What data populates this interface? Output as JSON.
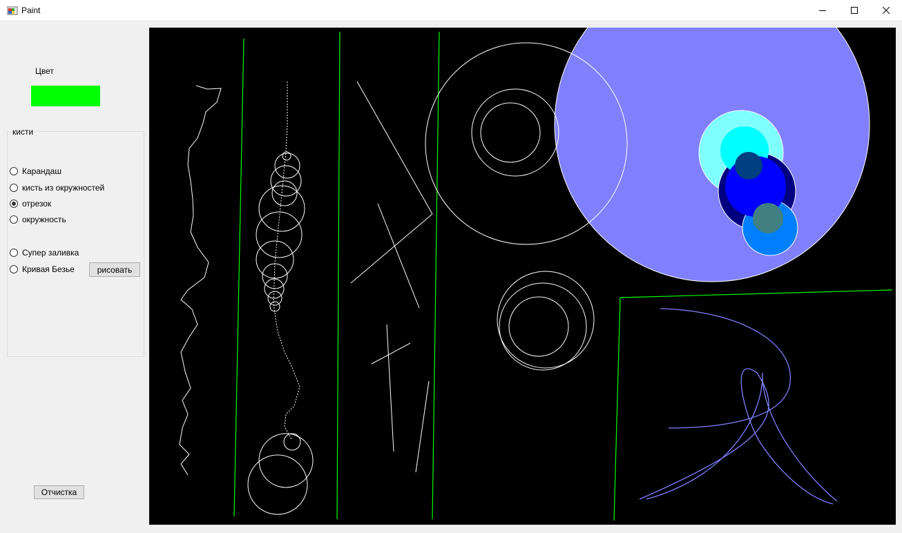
{
  "window": {
    "title": "Paint",
    "icons": {
      "app": "paint-app-icon",
      "minimize": "minimize-icon",
      "maximize": "maximize-icon",
      "close": "close-icon"
    }
  },
  "panel": {
    "color_label": "Цвет",
    "current_color": "#00ff00",
    "brushes_group_label": "кисти",
    "brushes": [
      {
        "label": "Карандаш",
        "checked": false
      },
      {
        "label": "кисть из окружностей",
        "checked": false
      },
      {
        "label": "отрезок",
        "checked": true
      },
      {
        "label": "окружность",
        "checked": false
      },
      {
        "label": "Супер заливка",
        "checked": false
      },
      {
        "label": "Кривая Безье",
        "checked": false
      }
    ],
    "draw_button_label": "рисовать",
    "clear_button_label": "Отчистка"
  },
  "canvas": {
    "background": "#000000",
    "colors": {
      "stroke": "#ffffff",
      "green_line": "#00ff00",
      "fill_lavender": "#8080ff",
      "fill_aqua_light": "#80ffff",
      "fill_aqua": "#00ffff",
      "fill_dark_blue": "#004080",
      "fill_blue": "#0000ff",
      "fill_navy": "#000080",
      "fill_teal": "#408080",
      "fill_azure": "#0080ff",
      "bezier": "#8080ff"
    }
  }
}
